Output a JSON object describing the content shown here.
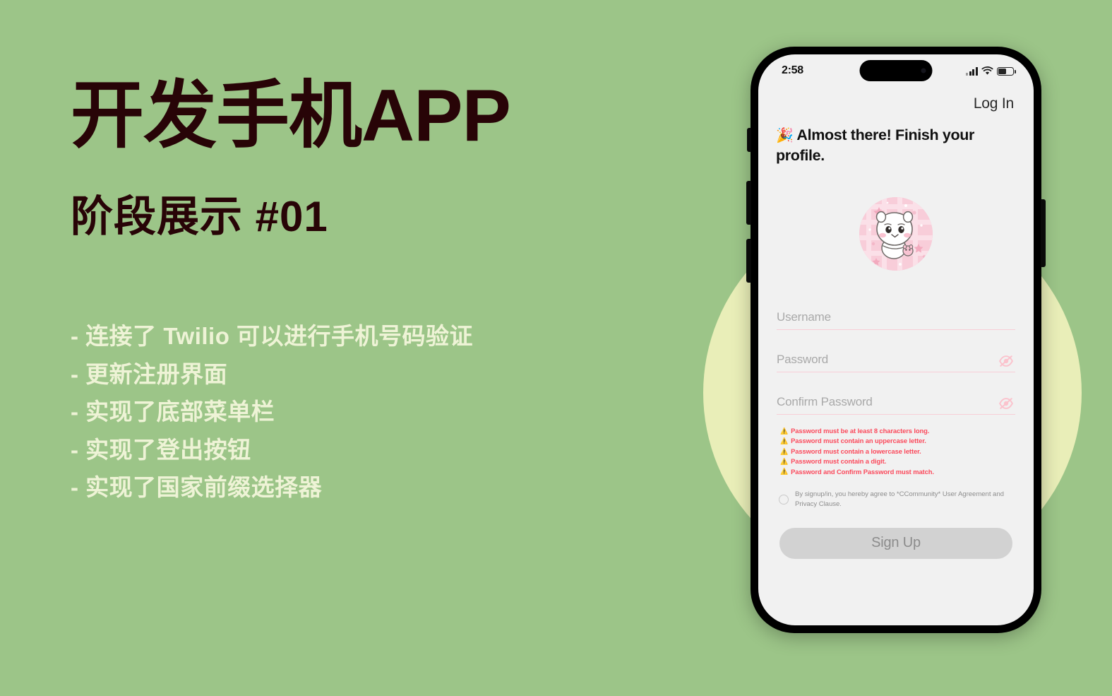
{
  "slide": {
    "title": "开发手机APP",
    "subtitle": "阶段展示 #01",
    "bullets": [
      "- 连接了 Twilio 可以进行手机号码验证",
      "- 更新注册界面",
      "- 实现了底部菜单栏",
      "- 实现了登出按钮",
      "- 实现了国家前缀选择器"
    ],
    "colors": {
      "background_green": "#9cc588",
      "backdrop_circle_yellow": "#e9eeb8",
      "title_text": "#280407",
      "bullet_text": "#eef3d6"
    }
  },
  "phone": {
    "status_bar": {
      "time": "2:58",
      "signal_icon": "cellular-signal-icon",
      "wifi_icon": "wifi-icon",
      "battery_icon": "battery-icon",
      "battery_level_percent": 52
    },
    "app": {
      "login_link": "Log In",
      "headline_emoji": "🎉",
      "headline": "Almost there! Finish your profile.",
      "avatar_alt": "profile-avatar",
      "fields": [
        {
          "placeholder": "Username",
          "value": "",
          "has_eye_toggle": false
        },
        {
          "placeholder": "Password",
          "value": "",
          "has_eye_toggle": true
        },
        {
          "placeholder": "Confirm Password",
          "value": "",
          "has_eye_toggle": true
        }
      ],
      "validation_errors": [
        "Password must be at least 8 characters long.",
        "Password must contain an uppercase letter.",
        "Password must contain a lowercase letter.",
        "Password must contain a digit.",
        "Password and Confirm Password must match."
      ],
      "warning_glyph": "⚠️",
      "consent_text": "By signup/in, you hereby agree to *CCommunity* User Agreement and Privacy Clause.",
      "consent_checked": false,
      "signup_button": "Sign Up",
      "signup_button_enabled": false,
      "colors": {
        "screen_background": "#f1f1f1",
        "field_underline_pink": "#f8ced6",
        "error_red": "#fb4a5c",
        "button_disabled": "#d2d2d2"
      }
    }
  }
}
